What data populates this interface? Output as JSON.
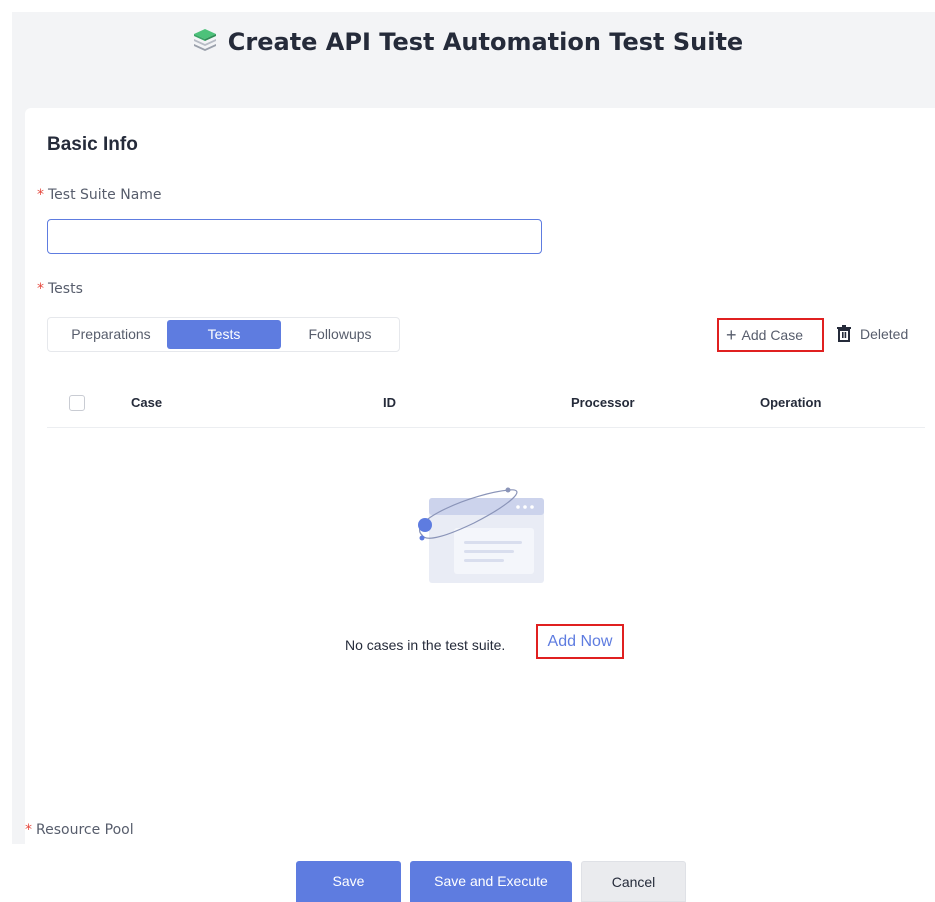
{
  "header": {
    "title": "Create API Test Automation Test Suite",
    "logo_icon": "stacked-layers-icon"
  },
  "basic_info": {
    "section_title": "Basic Info",
    "name_label": "Test Suite Name",
    "name_value": "",
    "name_placeholder": "",
    "tests_label": "Tests",
    "resource_pool_label": "Resource Pool",
    "required_mark": "*"
  },
  "tabs": [
    {
      "label": "Preparations",
      "active": false
    },
    {
      "label": "Tests",
      "active": true
    },
    {
      "label": "Followups",
      "active": false
    }
  ],
  "actions": {
    "add_case": "Add Case",
    "add_case_icon": "plus-icon",
    "deleted": "Deleted",
    "deleted_icon": "trash-icon"
  },
  "table": {
    "columns": [
      "Case",
      "ID",
      "Processor",
      "Operation"
    ],
    "empty_text": "No cases in the test suite.",
    "add_now": "Add Now"
  },
  "footer": {
    "save": "Save",
    "save_execute": "Save and Execute",
    "cancel": "Cancel"
  },
  "colors": {
    "primary": "#5e7ce0",
    "required": "#e5473c",
    "highlight_border": "#e02020",
    "page_bg": "#f3f4f6"
  }
}
